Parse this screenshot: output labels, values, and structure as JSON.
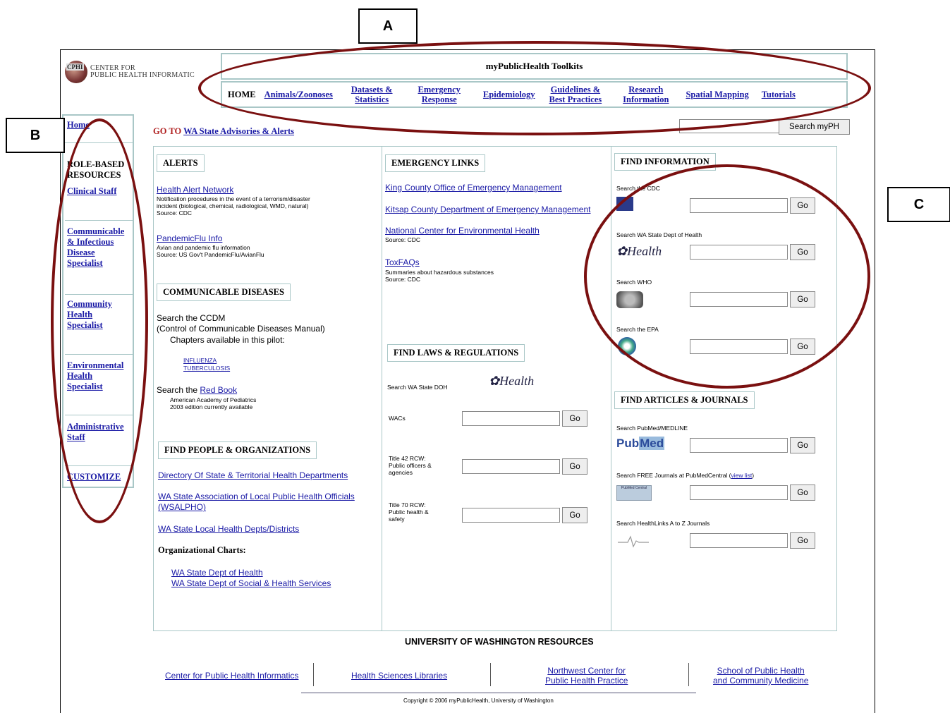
{
  "callouts": {
    "a": "A",
    "b": "B",
    "c": "C"
  },
  "logo": {
    "line1": "CENTER FOR",
    "line2": "PUBLIC HEALTH INFORMATIC",
    "mark": "CPHI"
  },
  "toolkits_title": "myPublicHealth Toolkits",
  "nav": {
    "home": "HOME",
    "animals": "Animals/Zoonoses",
    "datasets": [
      "Datasets &",
      "Statistics"
    ],
    "emergency": [
      "Emergency",
      "Response"
    ],
    "epidemiology": "Epidemiology",
    "guidelines": [
      "Guidelines &",
      "Best Practices"
    ],
    "research": [
      "Research",
      "Information"
    ],
    "spatial": "Spatial Mapping",
    "tutorials": "Tutorials"
  },
  "sidebar": {
    "home": "Home",
    "heading": [
      "ROLE-BASED",
      "RESOURCES"
    ],
    "clinical": "Clinical Staff",
    "communicable": [
      "Communicable",
      "& Infectious",
      "Disease",
      "Specialist"
    ],
    "community": [
      "Community",
      "Health",
      "Specialist"
    ],
    "environmental": [
      "Environmental",
      "Health",
      "Specialist"
    ],
    "administrative": [
      "Administrative",
      "Staff"
    ],
    "customize": "CUSTOMIZE"
  },
  "goto": {
    "prefix": "GO TO",
    "link": "WA State Advisories & Alerts"
  },
  "search_button": "Search myPH",
  "alerts": {
    "heading": "ALERTS",
    "han_link": "Health Alert Network",
    "han_desc": [
      "Notification procedures in the event of a terrorism/disaster",
      "incident (biological, chemical, radiological, WMD, natural)",
      "Source: CDC"
    ],
    "flu_link": "PandemicFlu Info",
    "flu_desc": [
      "Avian and pandemic flu information",
      "Source: US Gov't PandemicFlu/AvianFlu"
    ]
  },
  "communicable": {
    "heading": "COMMUNICABLE DISEASES",
    "line1": "Search the CCDM",
    "line2": "(Control of Communicable Diseases Manual)",
    "line3": "Chapters available in this pilot:",
    "influenza": "INFLUENZA",
    "tuberculosis": "TUBERCULOSIS",
    "redbook_prefix": "Search the",
    "redbook_link": "Red Book",
    "redbook_desc": [
      "American Academy of Pediatrics",
      "2003 edition currently available"
    ]
  },
  "people": {
    "heading": "FIND PEOPLE & ORGANIZATIONS",
    "links": [
      "Directory Of State & Territorial Health Departments",
      "WA State Association of Local Public Health Officials",
      "(WSALPHO)",
      "WA State Local Health Depts/Districts"
    ],
    "org_heading": "Organizational Charts:",
    "org_links": [
      "WA State Dept of Health",
      "WA State Dept of Social & Health Services"
    ]
  },
  "emergency_links": {
    "heading": "EMERGENCY LINKS",
    "king": "King County Office of Emergency Management",
    "kitsap": "Kitsap County Department of Emergency Management",
    "nceh": "National Center for Environmental Health",
    "nceh_src": "Source: CDC",
    "tox": "ToxFAQs",
    "tox_desc": [
      "Summaries about hazardous substances",
      "Source: CDC"
    ]
  },
  "laws": {
    "heading": "FIND LAWS & REGULATIONS",
    "search_label": "Search WA State DOH",
    "health_logo": "Health",
    "wacs": "WACs",
    "t42": [
      "Title 42 RCW:",
      "Public officers &",
      "agencies"
    ],
    "t70": [
      "Title 70 RCW:",
      "Public health &",
      "safety"
    ]
  },
  "find_info": {
    "heading": "FIND INFORMATION",
    "cdc": "Search the CDC",
    "doh": "Search WA State Dept of Health",
    "who": "Search WHO",
    "epa": "Search the EPA",
    "doh_logo": "Health"
  },
  "articles": {
    "heading": "FIND ARTICLES & JOURNALS",
    "pubmed": "Search PubMed/MEDLINE",
    "pubmed_logo_a": "Pub",
    "pubmed_logo_b": "Med",
    "pmc_prefix": "Search FREE Journals at PubMedCentral (",
    "pmc_link": "view list",
    "pmc_suffix": ")",
    "pmc_logo": "PubMed Central",
    "healthlinks": "Search HealthLinks A to Z Journals"
  },
  "go_label": "Go",
  "uw": {
    "heading": "UNIVERSITY OF WASHINGTON RESOURCES",
    "cphi": "Center for Public Health Informatics",
    "hsl": "Health Sciences Libraries",
    "nwc": [
      "Northwest Center for",
      "Public Health Practice"
    ],
    "sph": [
      "School of Public Health",
      "and Community Medicine"
    ],
    "copyright": "Copyright © 2006 myPublicHealth, University of Washington"
  },
  "colors": {
    "accent": "#7a1010",
    "link": "#1a1aa6",
    "border": "#a9c7c7"
  }
}
